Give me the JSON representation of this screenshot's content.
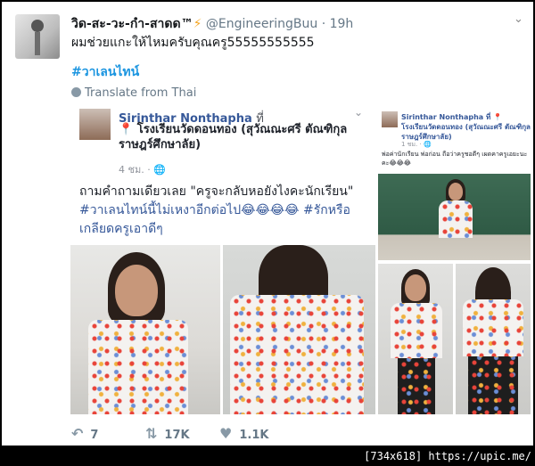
{
  "tweet": {
    "name": "วิด-สะ-วะ-กำ-สาดด™",
    "badge": "⚡",
    "handle": "@EngineeringBuu",
    "separator": "·",
    "time": "19h",
    "text": "ผมช่วยแกะให้ไหมครับคุณครู55555555555",
    "hashtag": "#วาเลนไทน์",
    "translate": "Translate from Thai"
  },
  "embed": {
    "author": "Sirinthar Nonthapha",
    "at": "ที่",
    "place": "📍 โรงเรียนวัดดอนทอง (สุวัณณะศรี ตัณฑิกุล ราษฎร์ศึกษาลัย)",
    "time": "4 ชม. · 🌐",
    "post_line1": "ถามคำถามเดียวเลย \"ครูจะกลับหอยังไงคะนักเรียน\"",
    "post_hashtag1": "#วาเลนไทน์นี้ไม่เหงาอีกต่อไป😂😂😂😂",
    "post_hashtag2": "#รักหรือเกลียดครูเอาดีๆ",
    "mini_author": "Sirinthar Nonthapha ที่ 📍 โรงเรียนวัดดอนทอง (สุวัณณะศรี ตัณฑิกุล ราษฎร์ศึกษาลัย)",
    "mini_time": "1 ชม. · 🌐",
    "mini_post": "พ่อค่านักเรียน พ่อก่อน ถือว่าครูชอดีๆ เผดคาครูเอยะนะคะ😂😂😂"
  },
  "actions": {
    "reply_icon": "reply-icon",
    "reply_count": "7",
    "retweet_icon": "retweet-icon",
    "retweet_count": "17K",
    "like_icon": "heart-icon",
    "like_count": "1.1K"
  },
  "footer": "[734x618] https://upic.me/",
  "colors": {
    "link": "#1b95e0",
    "fb_link": "#365899",
    "muted": "#657786"
  }
}
